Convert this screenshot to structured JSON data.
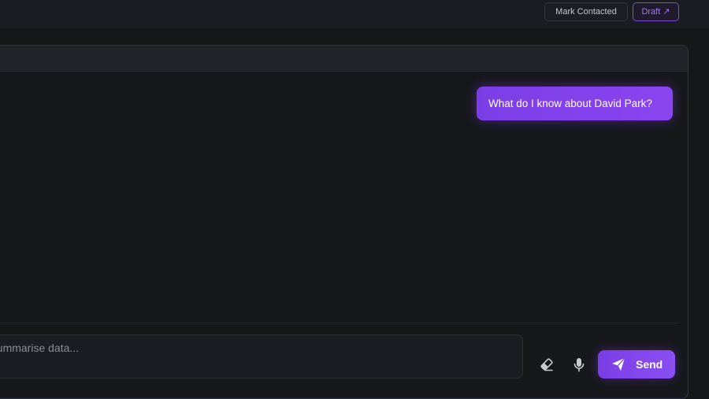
{
  "toolbar": {
    "mark_contacted_label": "Mark Contacted",
    "draft_label": "Draft ↗"
  },
  "chat": {
    "messages": [
      {
        "role": "user",
        "text": "What do I know about David Park?"
      }
    ]
  },
  "composer": {
    "placeholder": "...mails, summarise data...",
    "visible_placeholder": "s, summarise data...",
    "send_label": "Send",
    "icons": [
      "eraser-icon",
      "microphone-icon",
      "send-icon"
    ]
  },
  "colors": {
    "accent": "#7c3aed",
    "background": "#17181c"
  }
}
